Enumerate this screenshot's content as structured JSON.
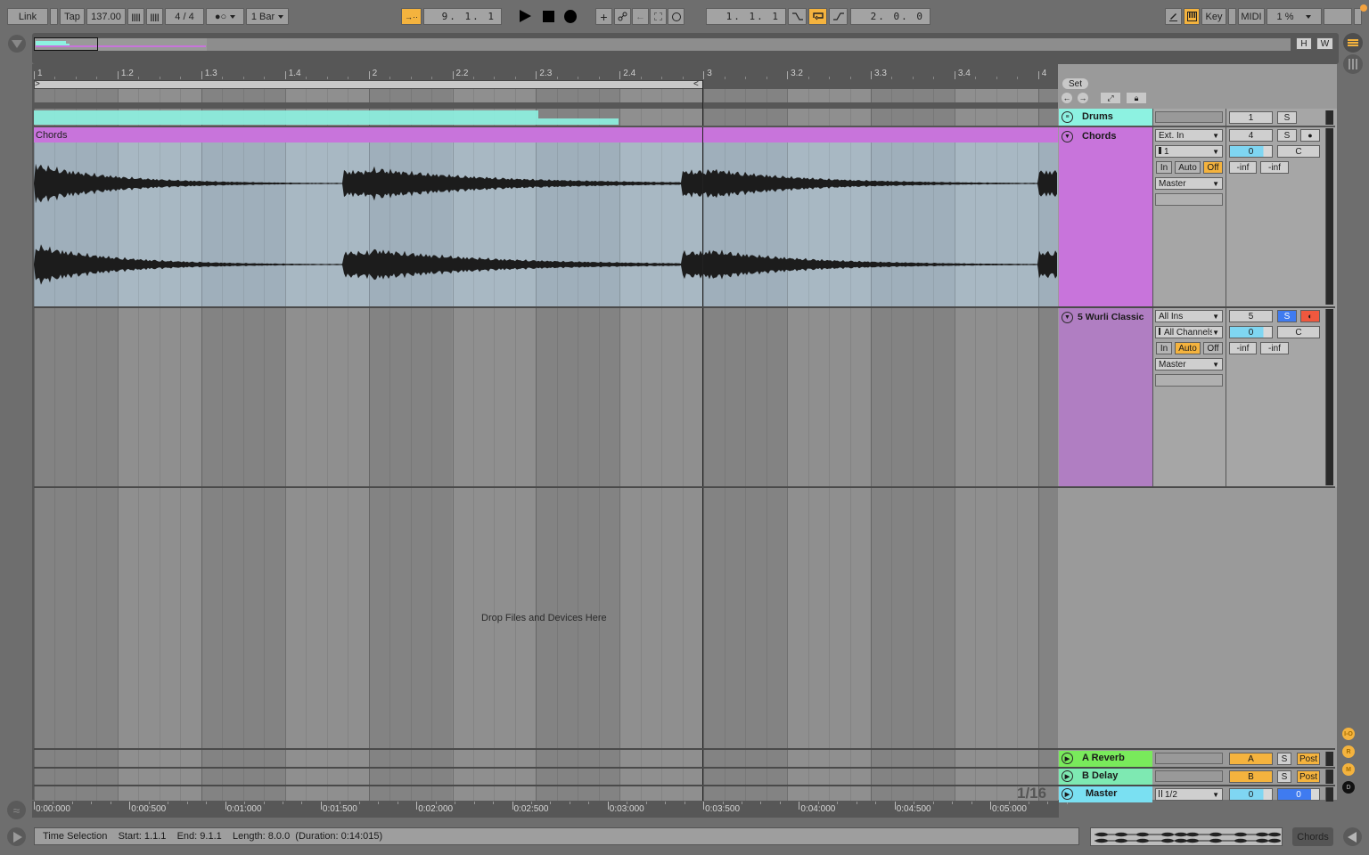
{
  "control_bar": {
    "link": "Link",
    "tap": "Tap",
    "tempo": "137.00",
    "nudge_down": "||||",
    "nudge_up": "||||",
    "time_signature": "4 / 4",
    "metronome": "●○",
    "quantization": "1 Bar",
    "follow_icon": "→··",
    "song_position": "9.  1.  1",
    "play_icon": "play-icon",
    "stop_icon": "stop-icon",
    "record_icon": "record-icon",
    "overdub": "+",
    "automation_arm": "automation-icon",
    "back_to_arrangement": "←",
    "capture": "capture-icon",
    "loop_record": "O",
    "loop_start": "1.  1.  1",
    "punch_in": "punch-in-icon",
    "loop_switch": "loop-icon",
    "punch_out": "punch-out-icon",
    "loop_length": "2.  0.  0",
    "draw_mode": "pencil-icon",
    "computer_midi_keyboard": "keyboard-icon",
    "key_map": "Key",
    "midi_map": "MIDI",
    "cpu_load": "1 %"
  },
  "overview": {
    "hide_label": "H",
    "width_label": "W"
  },
  "ruler": {
    "bars": [
      "1",
      "1.2",
      "1.3",
      "1.4",
      "2",
      "2.2",
      "2.3",
      "2.4",
      "3",
      "3.2",
      "3.3",
      "3.4",
      "4"
    ],
    "set_label": "Set"
  },
  "tracks": [
    {
      "name": "Drums",
      "color": "#8df2e1",
      "type": "group",
      "track_number": "1",
      "solo": "S"
    },
    {
      "name": "Chords",
      "color": "#c874db",
      "type": "audio",
      "clip_name": "Chords",
      "input_type": "Ext. In",
      "input_channel": "1",
      "monitor": [
        "In",
        "Auto",
        "Off"
      ],
      "monitor_active": "Off",
      "output": "Master",
      "track_number": "4",
      "solo": "S",
      "arm": "●",
      "volume": "0",
      "pan": "C",
      "peak_left": "-inf",
      "peak_right": "-inf"
    },
    {
      "name": "5 Wurli Classic",
      "color": "#b07ec2",
      "type": "midi",
      "input_type": "All Ins",
      "input_channel": "All Channels",
      "monitor": [
        "In",
        "Auto",
        "Off"
      ],
      "monitor_active": "Auto",
      "output": "Master",
      "track_number": "5",
      "solo": "S",
      "arm": "◐",
      "volume": "0",
      "pan": "C",
      "peak_left": "-inf",
      "peak_right": "-inf"
    }
  ],
  "drop_zone": "Drop Files and Devices Here",
  "returns": [
    {
      "name": "A Reverb",
      "color": "#79ea5b",
      "send": "A",
      "solo": "S",
      "mode": "Post"
    },
    {
      "name": "B Delay",
      "color": "#7ee9b2",
      "send": "B",
      "solo": "S",
      "mode": "Post"
    }
  ],
  "master": {
    "name": "Master",
    "color": "#7ae0f2",
    "output": "1/2",
    "volume": "0",
    "cue": "0"
  },
  "grid_label": "1/16",
  "side_buttons": [
    "I-O",
    "R",
    "M",
    "D"
  ],
  "time_ruler": [
    "0:00:000",
    "0:00:500",
    "0:01:000",
    "0:01:500",
    "0:02:000",
    "0:02:500",
    "0:03:000",
    "0:03:500",
    "0:04:000",
    "0:04:500",
    "0:05:000"
  ],
  "status_bar": {
    "text": "Time Selection    Start: 1.1.1    End: 9.1.1    Length: 8.0.0  (Duration: 0:14:015)",
    "track_label": "Chords"
  }
}
